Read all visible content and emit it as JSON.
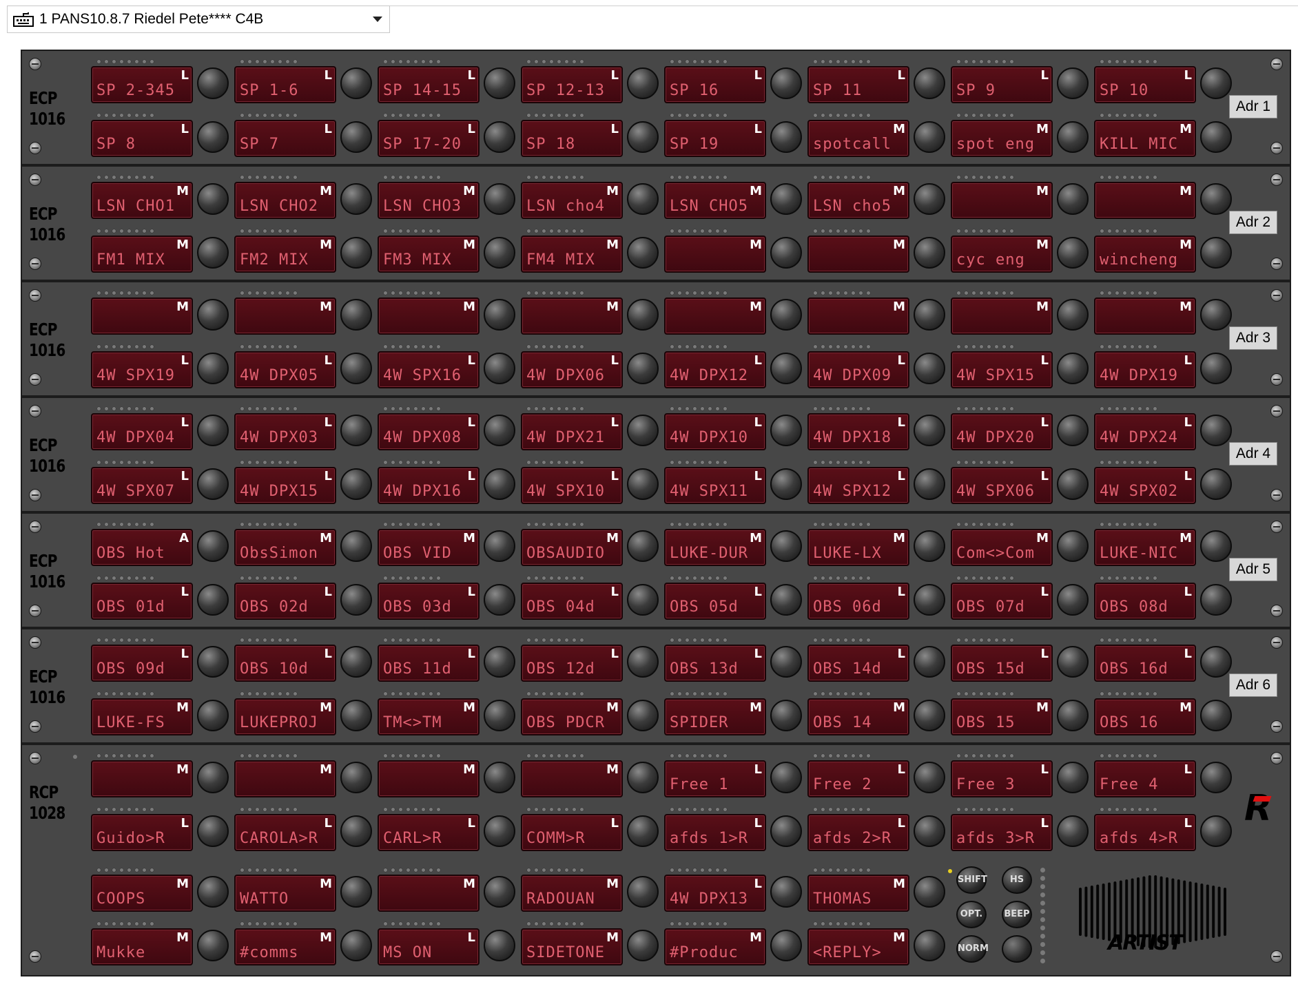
{
  "selector": {
    "label": "1 PANS10.8.7 Riedel Pete**** C4B",
    "icon": "keyboard-icon"
  },
  "colors": {
    "key_bg": "#4a0b14",
    "key_text": "#e06070",
    "panel": "#474747"
  },
  "panels": [
    {
      "model": [
        "ECP",
        "1016"
      ],
      "address": "Adr 1",
      "rows": [
        [
          {
            "l": "SP 2-345",
            "m": "L"
          },
          {
            "l": "SP 1-6",
            "m": "L"
          },
          {
            "l": "SP 14-15",
            "m": "L"
          },
          {
            "l": "SP 12-13",
            "m": "L"
          },
          {
            "l": "SP 16",
            "m": "L"
          },
          {
            "l": "SP 11",
            "m": "L"
          },
          {
            "l": "SP 9",
            "m": "L"
          },
          {
            "l": "SP 10",
            "m": "L"
          }
        ],
        [
          {
            "l": "SP 8",
            "m": "L"
          },
          {
            "l": "SP 7",
            "m": "L"
          },
          {
            "l": "SP 17-20",
            "m": "L"
          },
          {
            "l": "SP 18",
            "m": "L"
          },
          {
            "l": "SP 19",
            "m": "L"
          },
          {
            "l": "spotcall",
            "m": "M"
          },
          {
            "l": "spot eng",
            "m": "M"
          },
          {
            "l": "KILL MIC",
            "m": "M"
          }
        ]
      ]
    },
    {
      "model": [
        "ECP",
        "1016"
      ],
      "address": "Adr 2",
      "rows": [
        [
          {
            "l": "LSN CHO1",
            "m": "M"
          },
          {
            "l": "LSN CHO2",
            "m": "M"
          },
          {
            "l": "LSN CHO3",
            "m": "M"
          },
          {
            "l": "LSN cho4",
            "m": "M"
          },
          {
            "l": "LSN CHO5",
            "m": "M"
          },
          {
            "l": "LSN cho5",
            "m": "M"
          },
          {
            "l": "",
            "m": "M"
          },
          {
            "l": "",
            "m": "M"
          }
        ],
        [
          {
            "l": "FM1 MIX",
            "m": "M"
          },
          {
            "l": "FM2 MIX",
            "m": "M"
          },
          {
            "l": "FM3 MIX",
            "m": "M"
          },
          {
            "l": "FM4 MIX",
            "m": "M"
          },
          {
            "l": "",
            "m": "M"
          },
          {
            "l": "",
            "m": "M"
          },
          {
            "l": "cyc eng",
            "m": "M"
          },
          {
            "l": "wincheng",
            "m": "M"
          }
        ]
      ]
    },
    {
      "model": [
        "ECP",
        "1016"
      ],
      "address": "Adr 3",
      "rows": [
        [
          {
            "l": "",
            "m": "M"
          },
          {
            "l": "",
            "m": "M"
          },
          {
            "l": "",
            "m": "M"
          },
          {
            "l": "",
            "m": "M"
          },
          {
            "l": "",
            "m": "M"
          },
          {
            "l": "",
            "m": "M"
          },
          {
            "l": "",
            "m": "M"
          },
          {
            "l": "",
            "m": "M"
          }
        ],
        [
          {
            "l": "4W SPX19",
            "m": "L"
          },
          {
            "l": "4W DPX05",
            "m": "L"
          },
          {
            "l": "4W SPX16",
            "m": "L"
          },
          {
            "l": "4W DPX06",
            "m": "L"
          },
          {
            "l": "4W DPX12",
            "m": "L"
          },
          {
            "l": "4W DPX09",
            "m": "L"
          },
          {
            "l": "4W SPX15",
            "m": "L"
          },
          {
            "l": "4W DPX19",
            "m": "L"
          }
        ]
      ]
    },
    {
      "model": [
        "ECP",
        "1016"
      ],
      "address": "Adr 4",
      "rows": [
        [
          {
            "l": "4W DPX04",
            "m": "L"
          },
          {
            "l": "4W DPX03",
            "m": "L"
          },
          {
            "l": "4W DPX08",
            "m": "L"
          },
          {
            "l": "4W DPX21",
            "m": "L"
          },
          {
            "l": "4W DPX10",
            "m": "L"
          },
          {
            "l": "4W DPX18",
            "m": "L"
          },
          {
            "l": "4W DPX20",
            "m": "L"
          },
          {
            "l": "4W DPX24",
            "m": "L"
          }
        ],
        [
          {
            "l": "4W SPX07",
            "m": "L"
          },
          {
            "l": "4W DPX15",
            "m": "L"
          },
          {
            "l": "4W DPX16",
            "m": "L"
          },
          {
            "l": "4W SPX10",
            "m": "L"
          },
          {
            "l": "4W SPX11",
            "m": "L"
          },
          {
            "l": "4W SPX12",
            "m": "L"
          },
          {
            "l": "4W SPX06",
            "m": "L"
          },
          {
            "l": "4W SPX02",
            "m": "L"
          }
        ]
      ]
    },
    {
      "model": [
        "ECP",
        "1016"
      ],
      "address": "Adr 5",
      "rows": [
        [
          {
            "l": "OBS Hot",
            "m": "A"
          },
          {
            "l": "ObsSimon",
            "m": "M"
          },
          {
            "l": "OBS VID",
            "m": "M"
          },
          {
            "l": "OBSAUDIO",
            "m": "M"
          },
          {
            "l": "LUKE-DUR",
            "m": "M"
          },
          {
            "l": "LUKE-LX",
            "m": "M"
          },
          {
            "l": "Com<>Com",
            "m": "M"
          },
          {
            "l": "LUKE-NIC",
            "m": "M"
          }
        ],
        [
          {
            "l": "OBS 01d",
            "m": "L"
          },
          {
            "l": "OBS 02d",
            "m": "L"
          },
          {
            "l": "OBS 03d",
            "m": "L"
          },
          {
            "l": "OBS 04d",
            "m": "L"
          },
          {
            "l": "OBS 05d",
            "m": "L"
          },
          {
            "l": "OBS 06d",
            "m": "L"
          },
          {
            "l": "OBS 07d",
            "m": "L"
          },
          {
            "l": "OBS 08d",
            "m": "L"
          }
        ]
      ]
    },
    {
      "model": [
        "ECP",
        "1016"
      ],
      "address": "Adr 6",
      "rows": [
        [
          {
            "l": "OBS 09d",
            "m": "L"
          },
          {
            "l": "OBS 10d",
            "m": "L"
          },
          {
            "l": "OBS 11d",
            "m": "L"
          },
          {
            "l": "OBS 12d",
            "m": "L"
          },
          {
            "l": "OBS 13d",
            "m": "L"
          },
          {
            "l": "OBS 14d",
            "m": "L"
          },
          {
            "l": "OBS 15d",
            "m": "L"
          },
          {
            "l": "OBS 16d",
            "m": "L"
          }
        ],
        [
          {
            "l": "LUKE-FS",
            "m": "M"
          },
          {
            "l": "LUKEPROJ",
            "m": "M"
          },
          {
            "l": "TM<>TM",
            "m": "M"
          },
          {
            "l": "OBS PDCR",
            "m": "M"
          },
          {
            "l": "SPIDER",
            "m": "M"
          },
          {
            "l": "OBS 14",
            "m": "M"
          },
          {
            "l": "OBS 15",
            "m": "M"
          },
          {
            "l": "OBS 16",
            "m": "M"
          }
        ]
      ]
    }
  ],
  "rcp": {
    "model": [
      "RCP",
      "1028"
    ],
    "rows": [
      [
        {
          "l": "",
          "m": "M"
        },
        {
          "l": "",
          "m": "M"
        },
        {
          "l": "",
          "m": "M"
        },
        {
          "l": "",
          "m": "M"
        },
        {
          "l": "Free 1",
          "m": "L"
        },
        {
          "l": "Free 2",
          "m": "L"
        },
        {
          "l": "Free 3",
          "m": "L"
        },
        {
          "l": "Free 4",
          "m": "L"
        }
      ],
      [
        {
          "l": "Guido>R",
          "m": "L"
        },
        {
          "l": "CAROLA>R",
          "m": "L"
        },
        {
          "l": "CARL>R",
          "m": "L"
        },
        {
          "l": "COMM>R",
          "m": "L"
        },
        {
          "l": "afds 1>R",
          "m": "L"
        },
        {
          "l": "afds 2>R",
          "m": "L"
        },
        {
          "l": "afds 3>R",
          "m": "L"
        },
        {
          "l": "afds 4>R",
          "m": "L"
        }
      ],
      [
        {
          "l": "COOPS",
          "m": "M"
        },
        {
          "l": "WATTO",
          "m": "M"
        },
        {
          "l": "",
          "m": "M"
        },
        {
          "l": "RADOUAN",
          "m": "M"
        },
        {
          "l": "4W DPX13",
          "m": "L"
        },
        {
          "l": "THOMAS",
          "m": "M"
        }
      ],
      [
        {
          "l": "Mukke",
          "m": "M"
        },
        {
          "l": "#comms",
          "m": "M"
        },
        {
          "l": "MS ON",
          "m": "L"
        },
        {
          "l": "SIDETONE",
          "m": "M"
        },
        {
          "l": "#Produc",
          "m": "M"
        },
        {
          "l": "<REPLY>",
          "m": "M"
        }
      ]
    ],
    "controls": {
      "shift": "SHIFT",
      "hs": "HS",
      "opt": "OPT.",
      "beep": "BEEP",
      "norm": "NORM"
    },
    "brand": "ARTIST"
  }
}
